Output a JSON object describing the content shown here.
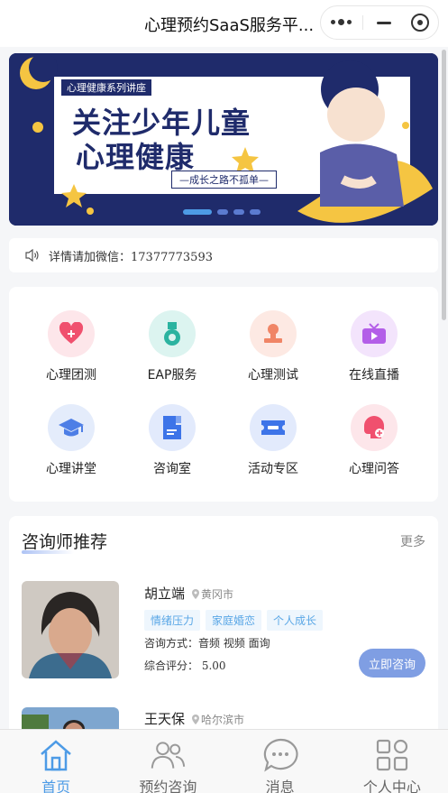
{
  "header": {
    "title": "心理预约SaaS服务平...",
    "more_icon": "more-dots-icon",
    "minimize_icon": "minimize-icon",
    "close_icon": "target-close-icon"
  },
  "banner": {
    "series_label": "心理健康系列讲座",
    "title_line1": "关注少年儿童",
    "title_line2": "心理健康",
    "subtitle": "—成长之路不孤单—",
    "pages": 4,
    "active_page": 1
  },
  "notice": {
    "icon": "speaker-icon",
    "text": "详情请加微信：17377773593"
  },
  "grid": {
    "items": [
      {
        "label": "心理团测",
        "icon": "heart-plus-icon",
        "color": "#f0506e",
        "bg": "#fde6ea"
      },
      {
        "label": "EAP服务",
        "icon": "medal-icon",
        "color": "#2bb3a0",
        "bg": "#dcf4f0"
      },
      {
        "label": "心理测试",
        "icon": "stamp-icon",
        "color": "#f08566",
        "bg": "#fde9e3"
      },
      {
        "label": "在线直播",
        "icon": "tv-icon",
        "color": "#b35ee8",
        "bg": "#f3e4fc"
      },
      {
        "label": "心理讲堂",
        "icon": "graduation-cap-icon",
        "color": "#4d7ee6",
        "bg": "#e4ecfb"
      },
      {
        "label": "咨询室",
        "icon": "document-icon",
        "color": "#3d74e8",
        "bg": "#e2eafc"
      },
      {
        "label": "活动专区",
        "icon": "ticket-icon",
        "color": "#3d74e8",
        "bg": "#e2eafc"
      },
      {
        "label": "心理问答",
        "icon": "head-chat-icon",
        "color": "#f0506e",
        "bg": "#fde6ea"
      }
    ]
  },
  "recommend": {
    "title": "咨询师推荐",
    "more": "更多",
    "counselors": [
      {
        "name": "胡立端",
        "location": "黄冈市",
        "tags": [
          "情绪压力",
          "家庭婚恋",
          "个人成长"
        ],
        "method": "咨询方式：音频 视频 面询",
        "score": "综合评分：  5.00",
        "button": "立即咨询"
      },
      {
        "name": "王天保",
        "location": "哈尔滨市"
      }
    ]
  },
  "tabbar": {
    "tabs": [
      {
        "label": "首页",
        "icon": "home-icon",
        "active": true
      },
      {
        "label": "预约咨询",
        "icon": "users-icon",
        "active": false
      },
      {
        "label": "消息",
        "icon": "chat-bubble-icon",
        "active": false
      },
      {
        "label": "个人中心",
        "icon": "grid-apps-icon",
        "active": false
      }
    ]
  },
  "colors": {
    "accent": "#4d9be6",
    "button": "#7f9ee3"
  }
}
